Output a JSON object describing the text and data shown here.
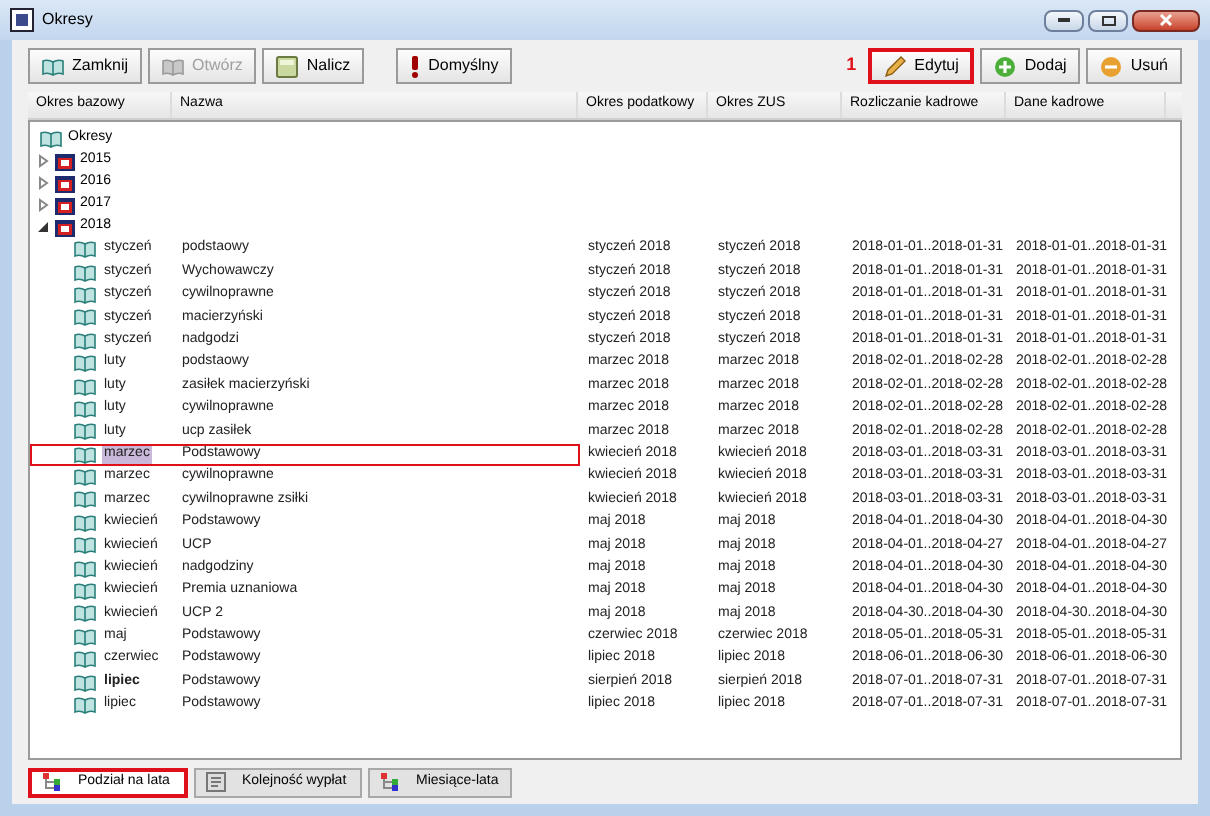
{
  "window": {
    "title": "Okresy"
  },
  "toolbar": {
    "left": [
      {
        "label": "Zamknij",
        "disabled": false,
        "highlighted": false
      },
      {
        "label": "Otwórz",
        "disabled": true,
        "highlighted": false
      },
      {
        "label": "Nalicz",
        "disabled": false,
        "highlighted": false
      },
      {
        "label": "Domyślny",
        "disabled": false,
        "highlighted": false
      }
    ],
    "step_number": "1",
    "right": [
      {
        "label": "Edytuj",
        "disabled": false,
        "highlighted": true
      },
      {
        "label": "Dodaj",
        "disabled": false,
        "highlighted": false
      },
      {
        "label": "Usuń",
        "disabled": false,
        "highlighted": false
      }
    ]
  },
  "columns": [
    "Okres bazowy",
    "Nazwa",
    "Okres podatkowy",
    "Okres ZUS",
    "Rozliczanie kadrowe",
    "Dane kadrowe"
  ],
  "tree": {
    "label": "Okresy",
    "children": [
      {
        "label": "2015",
        "expanded": false
      },
      {
        "label": "2016",
        "expanded": false
      },
      {
        "label": "2017",
        "expanded": false
      },
      {
        "label": "2018",
        "expanded": true,
        "rows": [
          {
            "cells": [
              "styczeń",
              "podstaowy",
              "styczeń 2018",
              "styczeń 2018",
              "2018-01-01..2018-01-31",
              "2018-01-01..2018-01-31"
            ],
            "selected": false,
            "highlighted": false,
            "bold": false
          },
          {
            "cells": [
              "styczeń",
              "Wychowawczy",
              "styczeń 2018",
              "styczeń 2018",
              "2018-01-01..2018-01-31",
              "2018-01-01..2018-01-31"
            ],
            "selected": false,
            "highlighted": false,
            "bold": false
          },
          {
            "cells": [
              "styczeń",
              "cywilnoprawne",
              "styczeń 2018",
              "styczeń 2018",
              "2018-01-01..2018-01-31",
              "2018-01-01..2018-01-31"
            ],
            "selected": false,
            "highlighted": false,
            "bold": false
          },
          {
            "cells": [
              "styczeń",
              "macierzyński",
              "styczeń 2018",
              "styczeń 2018",
              "2018-01-01..2018-01-31",
              "2018-01-01..2018-01-31"
            ],
            "selected": false,
            "highlighted": false,
            "bold": false
          },
          {
            "cells": [
              "styczeń",
              "nadgodzi",
              "styczeń 2018",
              "styczeń 2018",
              "2018-01-01..2018-01-31",
              "2018-01-01..2018-01-31"
            ],
            "selected": false,
            "highlighted": false,
            "bold": false
          },
          {
            "cells": [
              "luty",
              "podstaowy",
              "marzec 2018",
              "marzec 2018",
              "2018-02-01..2018-02-28",
              "2018-02-01..2018-02-28"
            ],
            "selected": false,
            "highlighted": false,
            "bold": false
          },
          {
            "cells": [
              "luty",
              "zasiłek macierzyński",
              "marzec 2018",
              "marzec 2018",
              "2018-02-01..2018-02-28",
              "2018-02-01..2018-02-28"
            ],
            "selected": false,
            "highlighted": false,
            "bold": false
          },
          {
            "cells": [
              "luty",
              "cywilnoprawne",
              "marzec 2018",
              "marzec 2018",
              "2018-02-01..2018-02-28",
              "2018-02-01..2018-02-28"
            ],
            "selected": false,
            "highlighted": false,
            "bold": false
          },
          {
            "cells": [
              "luty",
              "ucp zasiłek",
              "marzec 2018",
              "marzec 2018",
              "2018-02-01..2018-02-28",
              "2018-02-01..2018-02-28"
            ],
            "selected": false,
            "highlighted": false,
            "bold": false
          },
          {
            "cells": [
              "marzec",
              "Podstawowy",
              "kwiecień 2018",
              "kwiecień 2018",
              "2018-03-01..2018-03-31",
              "2018-03-01..2018-03-31"
            ],
            "selected": true,
            "highlighted": true,
            "bold": false
          },
          {
            "cells": [
              "marzec",
              "cywilnoprawne",
              "kwiecień 2018",
              "kwiecień 2018",
              "2018-03-01..2018-03-31",
              "2018-03-01..2018-03-31"
            ],
            "selected": false,
            "highlighted": false,
            "bold": false
          },
          {
            "cells": [
              "marzec",
              "cywilnoprawne zsiłki",
              "kwiecień 2018",
              "kwiecień 2018",
              "2018-03-01..2018-03-31",
              "2018-03-01..2018-03-31"
            ],
            "selected": false,
            "highlighted": false,
            "bold": false
          },
          {
            "cells": [
              "kwiecień",
              "Podstawowy",
              "maj 2018",
              "maj 2018",
              "2018-04-01..2018-04-30",
              "2018-04-01..2018-04-30"
            ],
            "selected": false,
            "highlighted": false,
            "bold": false
          },
          {
            "cells": [
              "kwiecień",
              "UCP",
              "maj 2018",
              "maj 2018",
              "2018-04-01..2018-04-27",
              "2018-04-01..2018-04-27"
            ],
            "selected": false,
            "highlighted": false,
            "bold": false
          },
          {
            "cells": [
              "kwiecień",
              "nadgodziny",
              "maj 2018",
              "maj 2018",
              "2018-04-01..2018-04-30",
              "2018-04-01..2018-04-30"
            ],
            "selected": false,
            "highlighted": false,
            "bold": false
          },
          {
            "cells": [
              "kwiecień",
              "Premia uznaniowa",
              "maj 2018",
              "maj 2018",
              "2018-04-01..2018-04-30",
              "2018-04-01..2018-04-30"
            ],
            "selected": false,
            "highlighted": false,
            "bold": false
          },
          {
            "cells": [
              "kwiecień",
              "UCP 2",
              "maj 2018",
              "maj 2018",
              "2018-04-30..2018-04-30",
              "2018-04-30..2018-04-30"
            ],
            "selected": false,
            "highlighted": false,
            "bold": false
          },
          {
            "cells": [
              "maj",
              "Podstawowy",
              "czerwiec 2018",
              "czerwiec 2018",
              "2018-05-01..2018-05-31",
              "2018-05-01..2018-05-31"
            ],
            "selected": false,
            "highlighted": false,
            "bold": false
          },
          {
            "cells": [
              "czerwiec",
              "Podstawowy",
              "lipiec 2018",
              "lipiec 2018",
              "2018-06-01..2018-06-30",
              "2018-06-01..2018-06-30"
            ],
            "selected": false,
            "highlighted": false,
            "bold": false
          },
          {
            "cells": [
              "lipiec",
              "Podstawowy",
              "sierpień 2018",
              "sierpień 2018",
              "2018-07-01..2018-07-31",
              "2018-07-01..2018-07-31"
            ],
            "selected": false,
            "highlighted": false,
            "bold": true
          },
          {
            "cells": [
              "lipiec",
              "Podstawowy",
              "lipiec 2018",
              "lipiec 2018",
              "2018-07-01..2018-07-31",
              "2018-07-01..2018-07-31"
            ],
            "selected": false,
            "highlighted": false,
            "bold": false
          }
        ]
      }
    ]
  },
  "tabs": [
    {
      "label": "Podział na lata",
      "selected": true,
      "highlighted": true
    },
    {
      "label": "Kolejność wypłat",
      "selected": false,
      "highlighted": false
    },
    {
      "label": "Miesiące-lata",
      "selected": false,
      "highlighted": false
    }
  ]
}
